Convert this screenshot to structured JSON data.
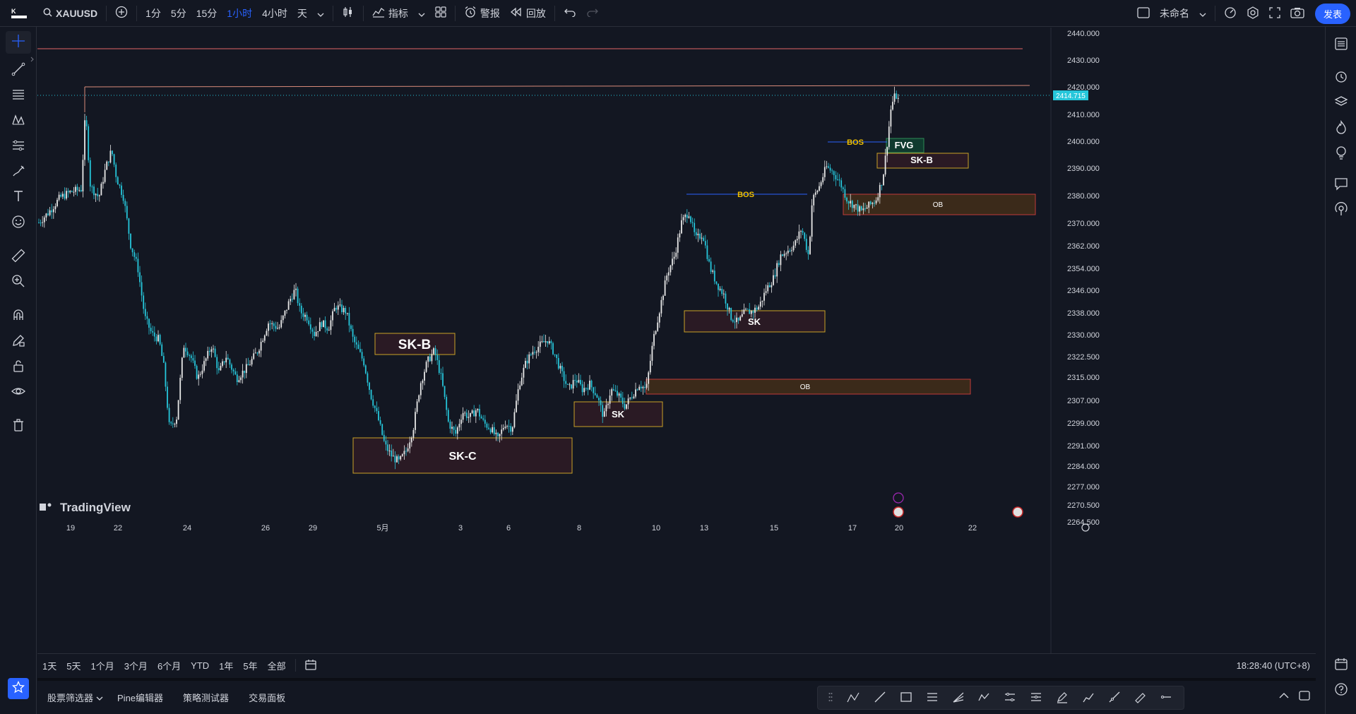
{
  "topbar": {
    "symbol": "XAUUSD",
    "intervals": [
      "1分",
      "5分",
      "15分",
      "1小时",
      "4小时",
      "天"
    ],
    "active_interval": "1小时",
    "indicators_label": "指标",
    "alert_label": "警报",
    "replay_label": "回放",
    "layout_name": "未命名",
    "publish_label": "发表"
  },
  "chart": {
    "watermark": "TradingView",
    "current_price": "2414.715",
    "price_axis": [
      "2440.000",
      "2430.000",
      "2420.000",
      "2410.000",
      "2400.000",
      "2390.000",
      "2380.000",
      "2370.000",
      "2362.000",
      "2354.000",
      "2346.000",
      "2338.000",
      "2330.000",
      "2322.500",
      "2315.000",
      "2307.000",
      "2299.000",
      "2291.000",
      "2284.000",
      "2277.000",
      "2270.500",
      "2264.500"
    ],
    "time_axis": [
      "19",
      "22",
      "24",
      "26",
      "29",
      "5月",
      "3",
      "6",
      "8",
      "10",
      "13",
      "15",
      "17",
      "20",
      "22"
    ],
    "annotations": {
      "sk_b_left": "SK-B",
      "sk_c": "SK-C",
      "sk_mid": "SK",
      "sk_right": "SK",
      "ob_mid": "OB",
      "ob_right": "OB",
      "bos_1": "BOS",
      "bos_2": "BOS",
      "fvg": "FVG",
      "sk_b_right": "SK-B"
    },
    "colors": {
      "up_candle": "#e8e8e8",
      "down_candle": "#26c6da",
      "zone_fill": "#2a1a24",
      "zone_border": "#c9a227",
      "ob_fill": "#3b2a1a",
      "ob_border": "#c23b3b",
      "fvg_fill": "#0f3a2e",
      "bos_text": "#f0c000",
      "bos_line": "#2962ff",
      "resistance_line": "#e06666"
    }
  },
  "rangebar": {
    "ranges": [
      "1天",
      "5天",
      "1个月",
      "3个月",
      "6个月",
      "YTD",
      "1年",
      "5年",
      "全部"
    ],
    "clock": "18:28:40 (UTC+8)"
  },
  "bottompanel": {
    "tabs": [
      "股票筛选器",
      "Pine编辑器",
      "策略测试器",
      "交易面板"
    ]
  }
}
